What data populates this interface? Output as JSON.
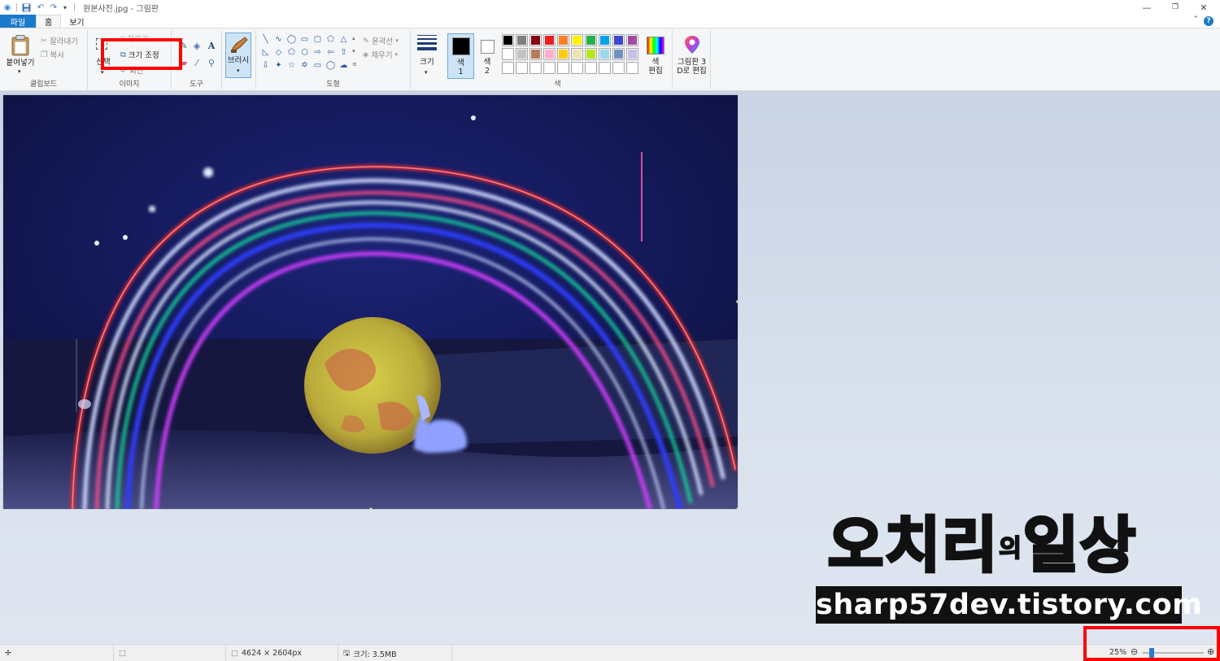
{
  "window": {
    "title": "원본사진.jpg - 그림판",
    "minimize_icon": "minimize-icon",
    "restore_icon": "restore-icon",
    "close_icon": "close-icon"
  },
  "tabs": {
    "file": "파일",
    "home": "홈",
    "view": "보기"
  },
  "clipboard": {
    "paste": "붙여넣기",
    "cut": "잘라내기",
    "copy": "복사",
    "group_label": "클립보드"
  },
  "image": {
    "select": "선택",
    "crop": "자르기",
    "resize": "크기 조정",
    "rotate": "회전",
    "group_label": "이미지"
  },
  "tools": {
    "group_label": "도구"
  },
  "brushes": {
    "label": "브러시"
  },
  "shapes": {
    "outline": "윤곽선",
    "fill": "채우기",
    "group_label": "도형"
  },
  "size": {
    "label": "크기"
  },
  "colors": {
    "color1_label_line1": "색",
    "color1_label_line2": "1",
    "color2_label_line1": "색",
    "color2_label_line2": "2",
    "edit_colors_line1": "색",
    "edit_colors_line2": "편집",
    "paint3d_line1": "그림판 3",
    "paint3d_line2": "D로 편집",
    "group_label": "색",
    "color1": "#000000",
    "color2": "#ffffff",
    "palette_row1": [
      "#000000",
      "#7f7f7f",
      "#880015",
      "#ed1c24",
      "#ff7f27",
      "#fff200",
      "#22b14c",
      "#00a2e8",
      "#3f48cc",
      "#a349a4"
    ],
    "palette_row2": [
      "#ffffff",
      "#c3c3c3",
      "#b97a57",
      "#ffaec9",
      "#ffc90e",
      "#efe4b0",
      "#b5e61d",
      "#99d9ea",
      "#7092be",
      "#c8bfe7"
    ],
    "palette_row3": [
      "#ffffff",
      "#ffffff",
      "#ffffff",
      "#ffffff",
      "#ffffff",
      "#ffffff",
      "#ffffff",
      "#ffffff",
      "#ffffff",
      "#ffffff"
    ]
  },
  "watermark": {
    "title_part1": "오치리",
    "title_small": "의",
    "title_part2": "일상",
    "url": "sharp57dev.tistory.com"
  },
  "status": {
    "dimensions": "4624 × 2604px",
    "file_size": "크기: 3.5MB",
    "zoom": "25%",
    "zoom_level": 0.25
  }
}
